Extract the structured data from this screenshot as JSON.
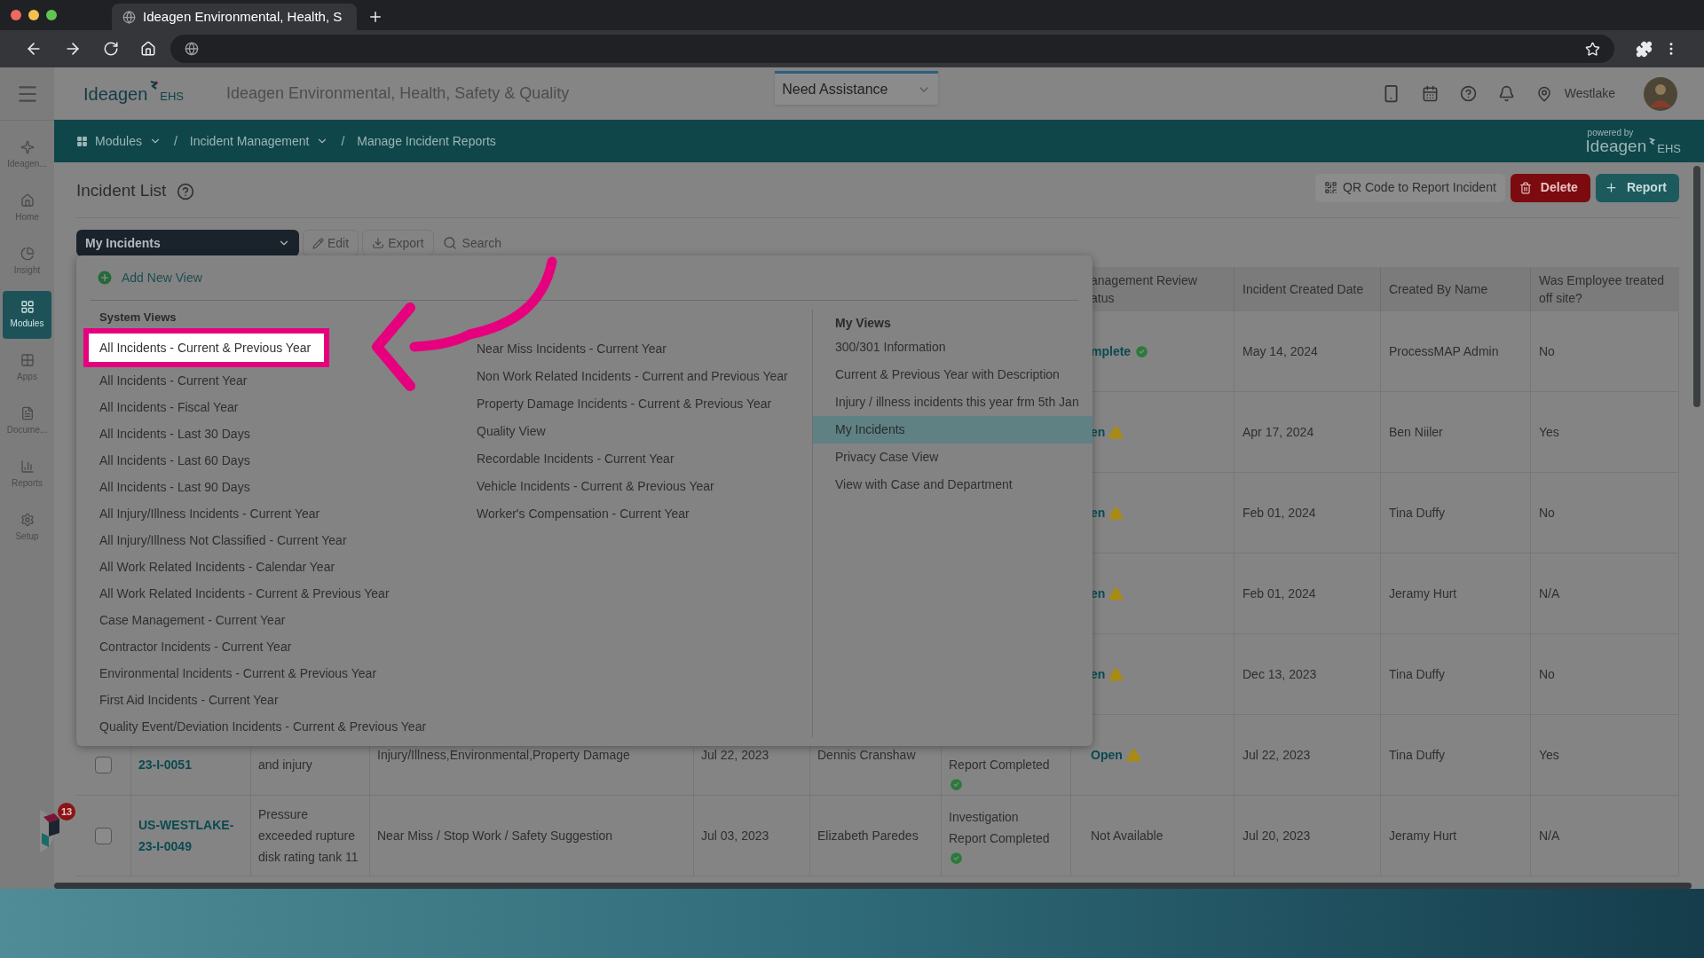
{
  "browser": {
    "tab_title": "Ideagen Environmental, Health, S"
  },
  "header": {
    "logo": {
      "name": "Ideagen",
      "suffix": "EHS"
    },
    "title": "Ideagen Environmental, Health, Safety & Quality",
    "assistance": "Need Assistance",
    "location": "Westlake"
  },
  "sidebar": {
    "items": [
      {
        "label": "Ideagen...",
        "kind": "ideagen",
        "selected": false
      },
      {
        "label": "Home",
        "kind": "home",
        "selected": false
      },
      {
        "label": "Insight",
        "kind": "insight",
        "selected": false
      },
      {
        "label": "Modules",
        "kind": "modules",
        "selected": true
      },
      {
        "label": "Apps",
        "kind": "apps",
        "selected": false
      },
      {
        "label": "Docume...",
        "kind": "documents",
        "selected": false
      },
      {
        "label": "Reports",
        "kind": "reports",
        "selected": false
      },
      {
        "label": "Setup",
        "kind": "setup",
        "selected": false
      }
    ]
  },
  "breadcrumb": [
    {
      "label": "Modules",
      "dropdown": true
    },
    {
      "separator": "/",
      "label": "Incident Management",
      "dropdown": true
    },
    {
      "separator": "/",
      "label": "Manage Incident Reports",
      "dropdown": false
    }
  ],
  "powered_by": {
    "caption": "powered by",
    "name": "Ideagen",
    "suffix": "EHS"
  },
  "page": {
    "title": "Incident List",
    "actions": [
      {
        "label": "QR Code to Report Incident",
        "kind": "qr"
      },
      {
        "label": "Delete",
        "kind": "delete"
      },
      {
        "label": "Report",
        "kind": "add"
      }
    ]
  },
  "toolbar": {
    "view": "My Incidents",
    "edit": "Edit",
    "export": "Export",
    "search_placeholder": "Search"
  },
  "view_menu": {
    "add_label": "Add New View",
    "system_heading": "System Views",
    "system_columns": [
      [
        {
          "label": "All Incidents - Current & Previous Year",
          "highlighted": true
        },
        {
          "label": "All Incidents - Current Year",
          "highlighted": false
        },
        {
          "label": "All Incidents - Fiscal Year",
          "highlighted": false
        },
        {
          "label": "All Incidents - Last 30 Days",
          "highlighted": false
        },
        {
          "label": "All Incidents - Last 60 Days",
          "highlighted": false
        },
        {
          "label": "All Incidents - Last 90 Days",
          "highlighted": false
        },
        {
          "label": "All Injury/Illness Incidents - Current Year",
          "highlighted": false
        },
        {
          "label": "All Injury/Illness Not Classified - Current Year",
          "highlighted": false
        },
        {
          "label": "All Work Related Incidents - Calendar Year",
          "highlighted": false
        },
        {
          "label": "All Work Related Incidents - Current & Previous Year",
          "highlighted": false
        },
        {
          "label": "Case Management - Current Year",
          "highlighted": false
        },
        {
          "label": "Contractor Incidents - Current Year",
          "highlighted": false
        },
        {
          "label": "Environmental Incidents - Current & Previous Year",
          "highlighted": false
        },
        {
          "label": "First Aid Incidents - Current Year",
          "highlighted": false
        },
        {
          "label": "Quality Event/Deviation Incidents - Current & Previous Year",
          "highlighted": false
        }
      ],
      [
        {
          "label": "Near Miss Incidents - Current Year",
          "highlighted": false
        },
        {
          "label": "Non Work Related Incidents - Current and Previous Year",
          "highlighted": false
        },
        {
          "label": "Property Damage Incidents - Current & Previous Year",
          "highlighted": false
        },
        {
          "label": "Quality View",
          "highlighted": false
        },
        {
          "label": "Recordable Incidents - Current Year",
          "highlighted": false
        },
        {
          "label": "Vehicle Incidents - Current & Previous Year",
          "highlighted": false
        },
        {
          "label": "Worker's Compensation - Current Year",
          "highlighted": false
        }
      ]
    ],
    "my_heading": "My Views",
    "my_views": [
      {
        "label": "300/301 Information",
        "selected": false
      },
      {
        "label": "Current & Previous Year with Description",
        "selected": false
      },
      {
        "label": "Injury / illness incidents this year frm 5th Jan",
        "selected": false
      },
      {
        "label": "My Incidents",
        "selected": true
      },
      {
        "label": "Privacy Case View",
        "selected": false
      },
      {
        "label": "View with Case and Department",
        "selected": false
      }
    ]
  },
  "table": {
    "columns": [
      "anagement Review\natus",
      "Incident Created Date",
      "Created By Name",
      "Was Employee treated off site?"
    ],
    "rows": [
      {
        "status": {
          "text": "mplete",
          "kind": "complete"
        },
        "created_date": "May 14, 2024",
        "created_by": "ProcessMAP Admin",
        "off_site": "No"
      },
      {
        "status": {
          "text": "en",
          "kind": "open"
        },
        "created_date": "Apr 17, 2024",
        "created_by": "Ben Niiler",
        "off_site": "Yes"
      },
      {
        "status": {
          "text": "en",
          "kind": "open"
        },
        "created_date": "Feb 01, 2024",
        "created_by": "Tina Duffy",
        "off_site": "No"
      },
      {
        "status": {
          "text": "en",
          "kind": "open"
        },
        "created_date": "Feb 01, 2024",
        "created_by": "Jeramy Hurt",
        "off_site": "N/A"
      },
      {
        "status": {
          "text": "en",
          "kind": "open"
        },
        "created_date": "Dec 13, 2023",
        "created_by": "Tina Duffy",
        "off_site": "No"
      },
      {
        "left": {
          "checked": false,
          "number": "23-I-0051",
          "description": "and injury",
          "type": "Injury/Illness,Environmental,Property Damage",
          "date": "Jul 22, 2023",
          "reported_by": "Dennis Cranshaw",
          "investigation": "Report Completed",
          "investigation_done": true
        },
        "status": {
          "text": "Open",
          "kind": "open"
        },
        "created_date": "Jul 22, 2023",
        "created_by": "Tina Duffy",
        "off_site": "Yes"
      },
      {
        "left": {
          "checked": false,
          "number": "US-WESTLAKE-23-I-0049",
          "description": "Pressure exceeded rupture disk rating tank 11",
          "type": "Near Miss / Stop Work / Safety Suggestion",
          "date": "Jul 03, 2023",
          "reported_by": "Elizabeth Paredes",
          "investigation": "Investigation Report Completed",
          "investigation_done": true
        },
        "status": {
          "text": "Not Available",
          "kind": "none"
        },
        "created_date": "Jul 20, 2023",
        "created_by": "Jeramy Hurt",
        "off_site": "N/A"
      }
    ]
  },
  "assistant_badge": "13"
}
